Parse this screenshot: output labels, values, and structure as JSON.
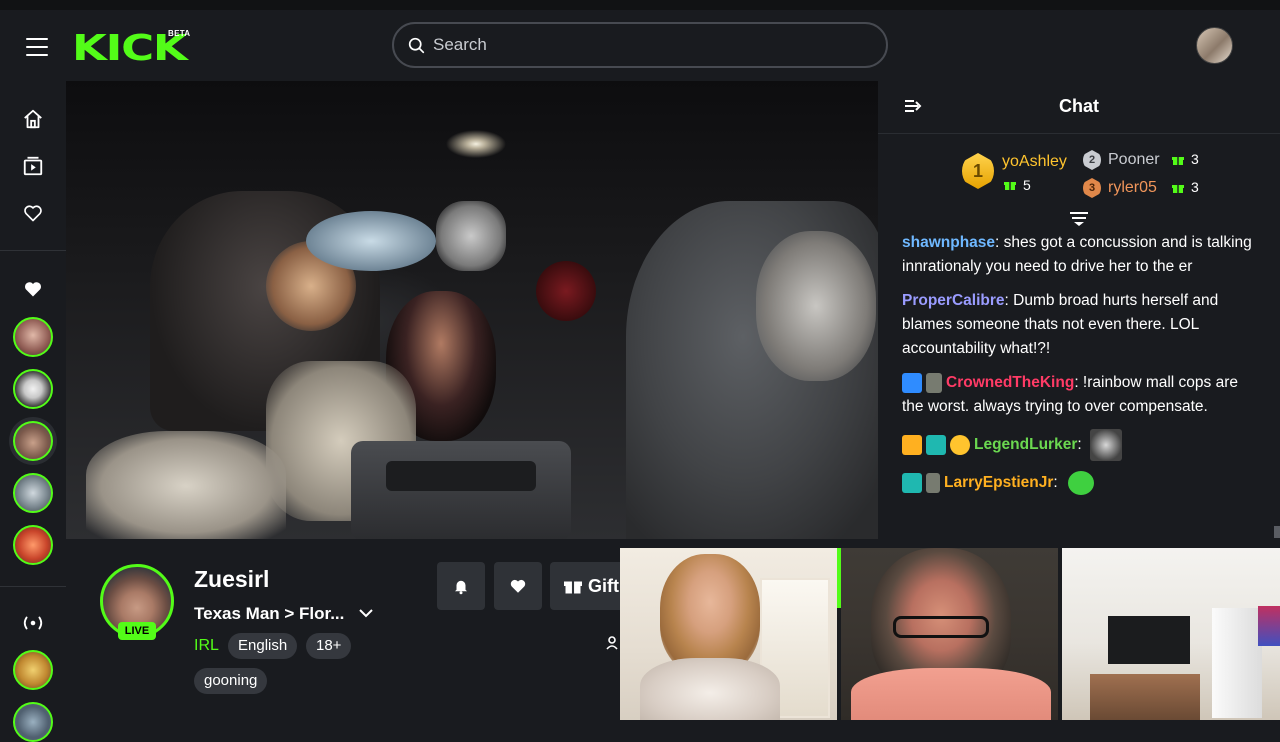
{
  "header": {
    "logo_text": "KICK",
    "logo_superscript": "BETA",
    "search_placeholder": "Search"
  },
  "sidebar": {
    "icons": [
      "home-icon",
      "browse-icon",
      "following-icon"
    ],
    "followed_channels": 5,
    "recommended_icon": "live-broadcast-icon"
  },
  "chat": {
    "title": "Chat",
    "leaderboard": {
      "first": {
        "rank": "1",
        "name": "yoAshley",
        "gifts": "5"
      },
      "second": {
        "rank": "2",
        "name": "Pooner",
        "gifts": "3"
      },
      "third": {
        "rank": "3",
        "name": "ryler05",
        "gifts": "3"
      }
    },
    "messages": [
      {
        "user": "shawnphase",
        "text": ": shes got a concussion and is talking innrationaly you need to drive her to the er"
      },
      {
        "user": "ProperCalibre",
        "text": ": Dumb broad hurts herself and blames someone thats not even there. LOL accountability what!?!"
      },
      {
        "user": "CrownedTheKing",
        "text": ": !rainbow mall cops are the worst. always trying to over compensate."
      },
      {
        "user": "LegendLurker",
        "text": ":"
      },
      {
        "user": "LarryEpstienJr",
        "text": ":"
      }
    ]
  },
  "stream": {
    "streamer_name": "Zuesirl",
    "live_label": "LIVE",
    "title": "Texas Man > Flor...",
    "category": "IRL",
    "tags": [
      "English",
      "18+",
      "gooning"
    ],
    "gift_label": "Gift"
  },
  "colors": {
    "brand": "#53fc18",
    "background": "#191b1f"
  }
}
